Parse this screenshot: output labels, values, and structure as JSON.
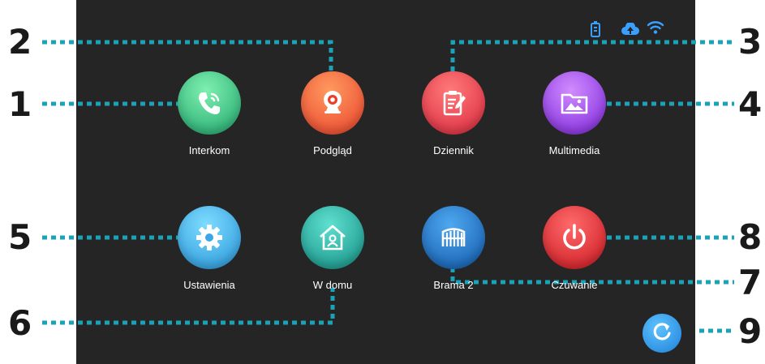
{
  "apps": [
    {
      "id": "interkom",
      "label": "Interkom",
      "icon": "phone-icon",
      "gradient": [
        "#6fe0a0",
        "#1da36a"
      ]
    },
    {
      "id": "podglad",
      "label": "Podgląd",
      "icon": "webcam-icon",
      "gradient": [
        "#ff8a4f",
        "#e8402a"
      ]
    },
    {
      "id": "dziennik",
      "label": "Dziennik",
      "icon": "clipboard-icon",
      "gradient": [
        "#ff6f6f",
        "#d8263a"
      ]
    },
    {
      "id": "multimedia",
      "label": "Multimedia",
      "icon": "folder-image-icon",
      "gradient": [
        "#c57bff",
        "#7a22d8"
      ]
    },
    {
      "id": "ustawienia",
      "label": "Ustawienia",
      "icon": "gear-icon",
      "gradient": [
        "#6fd3ff",
        "#2493d8"
      ]
    },
    {
      "id": "w-domu",
      "label": "W domu",
      "icon": "home-person-icon",
      "gradient": [
        "#4fd3c2",
        "#128c82"
      ]
    },
    {
      "id": "brama-2",
      "label": "Brama 2",
      "icon": "gate-icon",
      "gradient": [
        "#3f9be8",
        "#1057a8"
      ]
    },
    {
      "id": "czuwanie",
      "label": "Czuwanie",
      "icon": "power-icon",
      "gradient": [
        "#ff5a5a",
        "#c8161e"
      ]
    }
  ],
  "callouts": [
    "1",
    "2",
    "3",
    "4",
    "5",
    "6",
    "7",
    "8",
    "9"
  ],
  "status_icons": [
    "device-icon",
    "cloud-icon",
    "wifi-icon"
  ],
  "refresh_icon": "refresh-icon",
  "colors": {
    "screen": "#252525",
    "dotted": "#1aa3b8",
    "status": "#3aa0ff"
  }
}
